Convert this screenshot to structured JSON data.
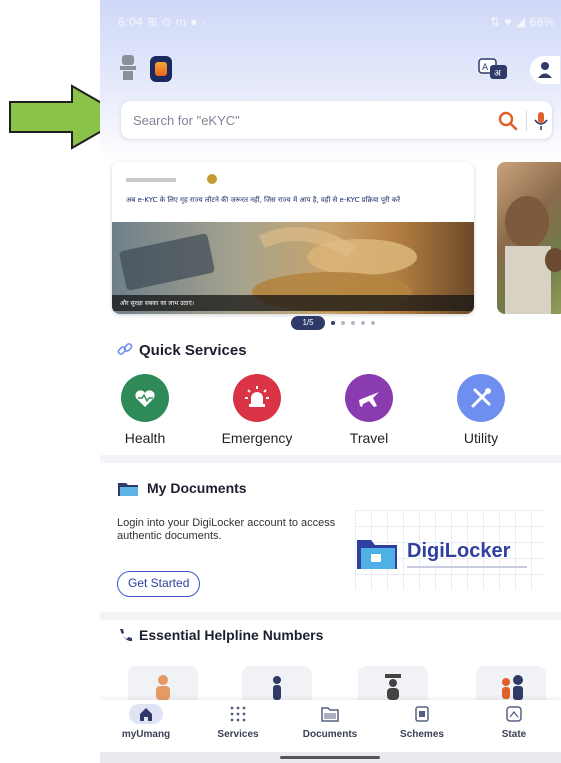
{
  "status_bar": {
    "time": "6:04",
    "icons": "⊞ ⊙ m ●  ·",
    "right": "⇅ ♥  ◢ 66%"
  },
  "search": {
    "placeholder": "Search for \"eKYC\""
  },
  "banner": {
    "text": "अब e-KYC के लिए गृह राज्य लौटने की जरूरत नहीं, जिस राज्य में आप है, वहीं से e-KYC प्रक्रिया पूरी करें",
    "caption": "और सुरक्षा सबका का लाभ उठाएं।",
    "pager_label": "1/5",
    "pager_total": 5,
    "pager_active": 1
  },
  "quick_services": {
    "title": "Quick Services",
    "items": [
      {
        "label": "Health",
        "icon": "heart-icon",
        "color": "#2e8b57"
      },
      {
        "label": "Emergency",
        "icon": "alarm-icon",
        "color": "#d93345"
      },
      {
        "label": "Travel",
        "icon": "airplane-icon",
        "color": "#8a3bb0"
      },
      {
        "label": "Utility",
        "icon": "tools-icon",
        "color": "#6f8ff0"
      }
    ]
  },
  "my_documents": {
    "title": "My Documents",
    "description": "Login into your DigiLocker account to access authentic documents.",
    "button": "Get Started",
    "brand": "DigiLocker"
  },
  "helpline": {
    "title": "Essential Helpline Numbers"
  },
  "bottom_nav": [
    {
      "label": "myUmang",
      "icon": "home-icon",
      "active": true
    },
    {
      "label": "Services",
      "icon": "grid-icon",
      "active": false
    },
    {
      "label": "Documents",
      "icon": "documents-icon",
      "active": false
    },
    {
      "label": "Schemes",
      "icon": "schemes-icon",
      "active": false
    },
    {
      "label": "State",
      "icon": "map-icon",
      "active": false
    }
  ],
  "colors": {
    "primary": "#2f3a68",
    "arrow": "#8bc34a"
  }
}
